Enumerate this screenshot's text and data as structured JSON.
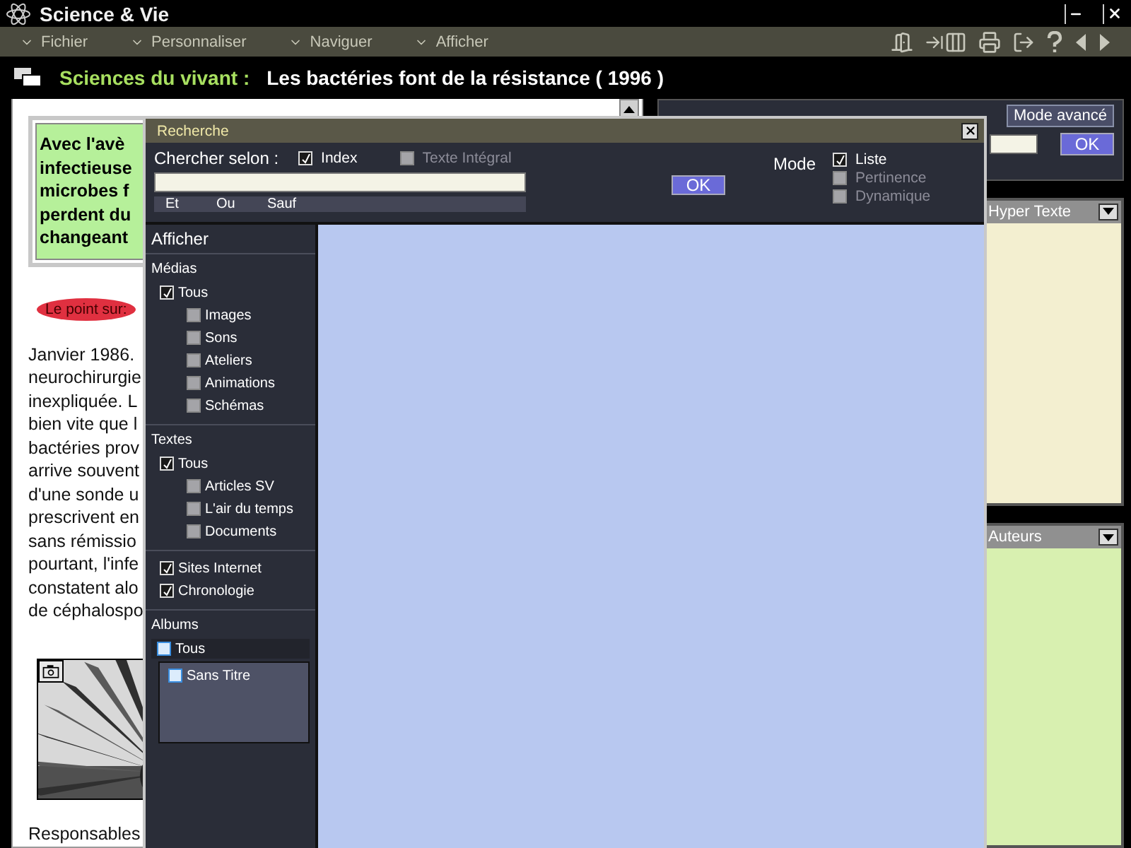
{
  "app_title": "Science & Vie",
  "menu": [
    {
      "label": "Fichier"
    },
    {
      "label": "Personnaliser"
    },
    {
      "label": "Naviguer"
    },
    {
      "label": "Afficher"
    }
  ],
  "heading": {
    "section": "Sciences du vivant :",
    "title": "Les bactéries font de la résistance ( 1996 )"
  },
  "article": {
    "summary_lines": [
      "Avec l'avè",
      "infectieuse",
      "microbes f",
      "perdent du",
      "changeant"
    ],
    "badge": "Le point sur:",
    "lines": [
      "Janvier 1986.",
      "neurochirurgie",
      "inexpliquée. L",
      "bien vite que l",
      "bactéries prov",
      "arrive souvent",
      "d'une sonde u",
      "prescrivent en",
      "sans rémissio",
      "pourtant, l'infe",
      "constatent alo",
      "de céphalospo"
    ],
    "after_photo": "Responsables"
  },
  "side_search": {
    "advanced_button": "Mode avancé",
    "ok_button": "OK"
  },
  "panels": [
    {
      "title": "Hyper Texte",
      "kind": "hypertext"
    },
    {
      "title": "Auteurs",
      "kind": "authors"
    }
  ],
  "dialog": {
    "title": "Recherche",
    "search_by_label": "Chercher selon :",
    "options": [
      {
        "label": "Index",
        "checked": true
      },
      {
        "label": "Texte Intégral",
        "checked": false
      }
    ],
    "ok_button": "OK",
    "operators": [
      "Et",
      "Ou",
      "Sauf"
    ],
    "mode_label": "Mode",
    "modes": [
      {
        "label": "Liste",
        "checked": true
      },
      {
        "label": "Pertinence",
        "checked": false
      },
      {
        "label": "Dynamique",
        "checked": false
      }
    ],
    "sidebar_title": "Afficher",
    "groups": [
      {
        "title": "Médias",
        "kind": "filter",
        "items": [
          {
            "label": "Tous",
            "checked": true,
            "children": [
              {
                "label": "Images",
                "checked": false
              },
              {
                "label": "Sons",
                "checked": false
              },
              {
                "label": "Ateliers",
                "checked": false
              },
              {
                "label": "Animations",
                "checked": false
              },
              {
                "label": "Schémas",
                "checked": false
              }
            ]
          }
        ]
      },
      {
        "title": "Textes",
        "kind": "filter",
        "items": [
          {
            "label": "Tous",
            "checked": true,
            "children": [
              {
                "label": "Articles SV",
                "checked": false
              },
              {
                "label": "L'air du temps",
                "checked": false
              },
              {
                "label": "Documents",
                "checked": false
              }
            ]
          }
        ]
      },
      {
        "kind": "filter",
        "items": [
          {
            "label": "Sites Internet",
            "checked": true
          },
          {
            "label": "Chronologie",
            "checked": true
          }
        ]
      },
      {
        "title": "Albums",
        "kind": "album",
        "items": [
          {
            "label": "Tous",
            "checked": false,
            "children": [
              {
                "label": "Sans Titre",
                "checked": false
              }
            ]
          }
        ]
      }
    ]
  }
}
